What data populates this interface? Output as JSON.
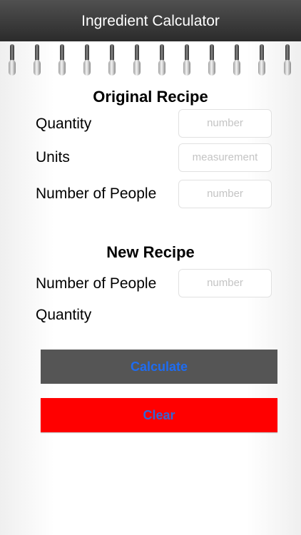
{
  "app": {
    "title": "Ingredient Calculator"
  },
  "original": {
    "heading": "Original Recipe",
    "quantity_label": "Quantity",
    "quantity_placeholder": "number",
    "units_label": "Units",
    "units_placeholder": "measurement",
    "people_label": "Number of People",
    "people_placeholder": "number"
  },
  "new_recipe": {
    "heading": "New Recipe",
    "people_label": "Number of People",
    "people_placeholder": "number",
    "quantity_label": "Quantity"
  },
  "actions": {
    "calculate_label": "Calculate",
    "clear_label": "Clear"
  },
  "colors": {
    "calculate_bg": "#555555",
    "clear_bg": "#ff0000",
    "button_text": "#1e6cf2"
  }
}
